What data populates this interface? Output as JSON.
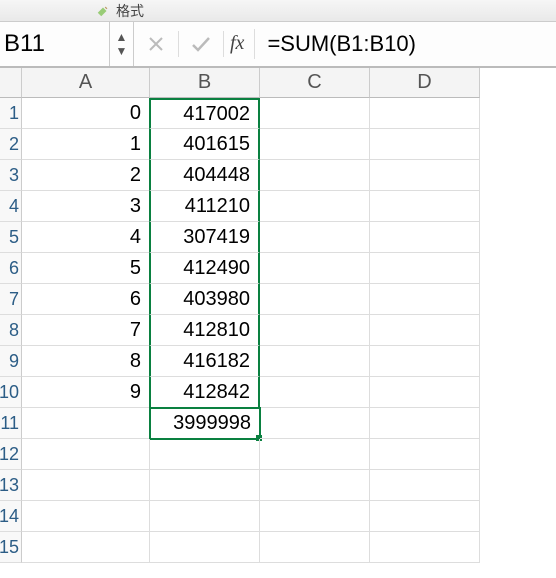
{
  "toolbar": {
    "format_label": "格式"
  },
  "formula_bar": {
    "name_box": "B11",
    "fx_label": "fx",
    "formula": "=SUM(B1:B10)"
  },
  "columns": [
    "A",
    "B",
    "C",
    "D"
  ],
  "visible_row_labels": [
    "1",
    "2",
    "3",
    "4",
    "5",
    "6",
    "7",
    "8",
    "9",
    "10",
    "11",
    "12",
    "13",
    "14",
    "15"
  ],
  "col_a": [
    "0",
    "1",
    "2",
    "3",
    "4",
    "5",
    "6",
    "7",
    "8",
    "9",
    "",
    "",
    "",
    "",
    ""
  ],
  "col_b": [
    "417002",
    "401615",
    "404448",
    "411210",
    "307419",
    "412490",
    "403980",
    "412810",
    "416182",
    "412842",
    "3999998",
    "",
    "",
    "",
    ""
  ],
  "active_cell": "B11"
}
